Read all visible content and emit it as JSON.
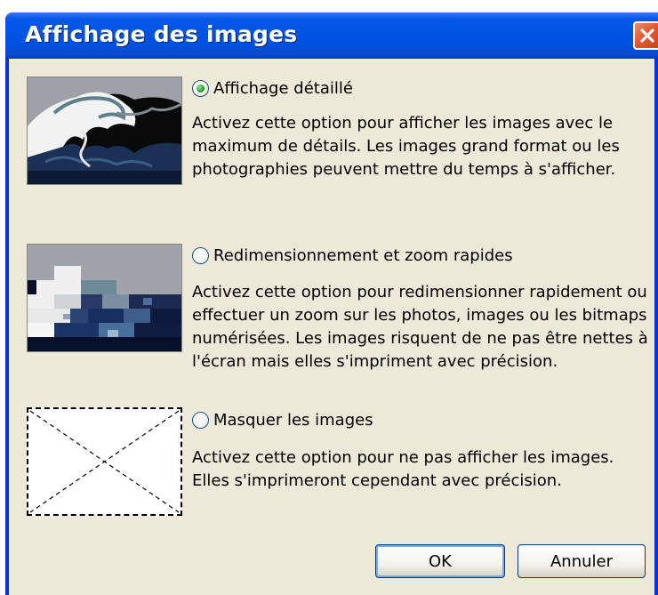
{
  "dialog": {
    "title": "Affichage des images",
    "close_icon": "close-icon"
  },
  "options": [
    {
      "label": "Affichage détaillé",
      "selected": true,
      "description": "Activez cette option pour afficher les images avec le maximum de détails. Les images grand format ou les photographies peuvent mettre du temps à s'afficher."
    },
    {
      "label": "Redimensionnement et zoom rapides",
      "selected": false,
      "description": "Activez cette option pour redimensionner rapidement ou effectuer un zoom sur les photos, images ou les bitmaps numérisées. Les images risquent de ne pas être nettes à l'écran mais elles s'impriment avec précision."
    },
    {
      "label": "Masquer les images",
      "selected": false,
      "description": "Activez cette option pour ne pas afficher les images. Elles s'imprimeront cependant avec précision."
    }
  ],
  "buttons": {
    "ok": "OK",
    "cancel": "Annuler"
  },
  "colors": {
    "title_bar": "#0055e5",
    "dialog_background": "#ece9d8",
    "close_button": "#e25a33",
    "radio_dot": "#21a121"
  }
}
